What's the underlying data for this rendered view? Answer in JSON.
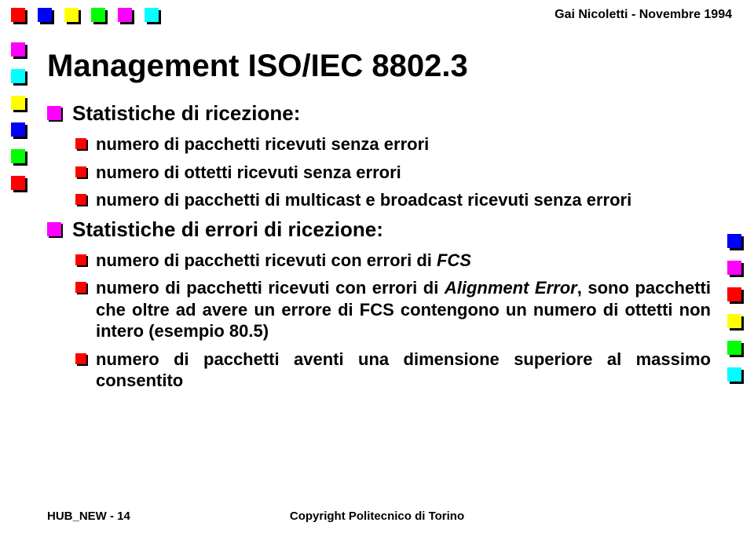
{
  "header": {
    "attrib": "Gai Nicoletti - Novembre 1994"
  },
  "title": "Management ISO/IEC 8802.3",
  "sections": [
    {
      "heading": "Statistiche di ricezione:",
      "items": [
        {
          "plain": "numero di pacchetti ricevuti senza errori"
        },
        {
          "plain": "numero di ottetti ricevuti senza errori"
        },
        {
          "plain": "numero di pacchetti di multicast e broadcast ricevuti senza errori"
        }
      ]
    },
    {
      "heading": "Statistiche di errori di ricezione:",
      "items": [
        {
          "pre": "numero di pacchetti ricevuti con errori di ",
          "em": "FCS",
          "post": ""
        },
        {
          "pre": "numero di pacchetti ricevuti con errori di ",
          "em": "Alignment Error",
          "post": ", sono pacchetti che oltre ad avere un errore di FCS contengono un numero di ottetti non intero (esempio 80.5)"
        },
        {
          "plain": "numero di pacchetti aventi una dimensione superiore al massimo consentito"
        }
      ]
    }
  ],
  "footer": {
    "left": "HUB_NEW - 14",
    "center": "Copyright Politecnico di Torino"
  },
  "deco": {
    "top_colors": [
      "#ff0000",
      "#0000ff",
      "#ffff00",
      "#00ff00",
      "#ff00ff",
      "#00ffff"
    ],
    "left_colors": [
      "#ff00ff",
      "#00ffff",
      "#ffff00",
      "#0000ff",
      "#00ff00",
      "#ff0000"
    ],
    "right_colors": [
      "#0000ff",
      "#ff00ff",
      "#ff0000",
      "#ffff00",
      "#00ff00",
      "#00ffff"
    ]
  }
}
